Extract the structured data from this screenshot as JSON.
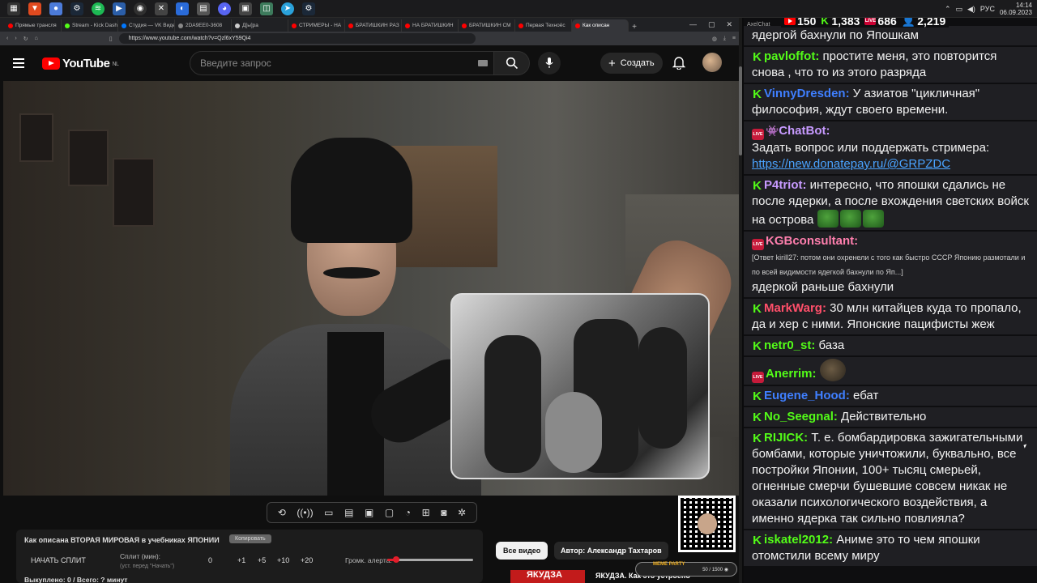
{
  "taskbar": {
    "icons": [
      "menu-icon",
      "browser-icon",
      "chrome-icon",
      "steam-icon",
      "spotify-icon",
      "media-icon",
      "obs-icon",
      "game-icon",
      "app-icon",
      "app-icon",
      "discord-icon",
      "app-icon",
      "telegram-icon",
      "app-icon",
      "steam-icon"
    ],
    "lang": "РУС",
    "time": "14:14",
    "date": "06.09.2023"
  },
  "browser": {
    "tabs": [
      {
        "label": "Прямые трансля",
        "color": "#ff0000"
      },
      {
        "label": "Stream - Kick Dash",
        "color": "#53fc18"
      },
      {
        "label": "Студия — VK Видео",
        "color": "#0077ff"
      },
      {
        "label": "2DA9EE0-3608",
        "color": "#888888"
      },
      {
        "label": "Д[ы]ра",
        "color": "#cccccc"
      },
      {
        "label": "СТРИМЕРЫ - НА",
        "color": "#ff0000"
      },
      {
        "label": "БРАТИШКИН РАЗ",
        "color": "#ff0000"
      },
      {
        "label": "НА БРАТИШКИН",
        "color": "#ff0000"
      },
      {
        "label": "БРАТИШКИН СМ",
        "color": "#ff0000"
      },
      {
        "label": "Первая Техноёс",
        "color": "#ff0000"
      },
      {
        "label": "Как описан",
        "color": "#ff0000"
      }
    ],
    "url": "https://www.youtube.com/watch?v=Qzl6xY59Qi4"
  },
  "youtube": {
    "logo": "YouTube",
    "region": "NL",
    "search_placeholder": "Введите запрос",
    "create_label": "Создать"
  },
  "video_controls": [
    "repeat-icon",
    "broadcast-icon",
    "cast-icon",
    "clapper-icon",
    "picture-icon",
    "window-icon",
    "speed-icon",
    "add-video-icon",
    "camera-icon",
    "settings-icon"
  ],
  "split_panel": {
    "title": "Как описана ВТОРАЯ МИРОВАЯ в учебниках ЯПОНИИ",
    "copy": "Копировать",
    "start": "НАЧАТЬ СПЛИТ",
    "split_min": "Сплит (мин):",
    "split_hint": "(уст. перед \"Начать\")",
    "value": "0",
    "increments": [
      "+1",
      "+5",
      "+10",
      "+20"
    ],
    "alert_label": "Громк. алерта:",
    "alert_volume": 0.1,
    "bought": "Выкуплено: 0 / Всего: ? минут"
  },
  "chips": {
    "all": "Все видео",
    "author": "Автор: Александр Тахтаров"
  },
  "reco": {
    "thumb_text": "ЯКУДЗА",
    "title": "ЯКУДЗА. Как это устроено"
  },
  "meme": {
    "tag": "MEME PARTY",
    "counter": "50 / 1500 ◉"
  },
  "chat": {
    "app": "AxelChat",
    "stats": {
      "youtube": "150",
      "kick": "1,383",
      "vk": "686",
      "viewers": "2,219"
    },
    "messages": [
      {
        "platform": "none",
        "nick": "",
        "color": "#ffffff",
        "text": "ядергой бахнули по Япошкам"
      },
      {
        "platform": "kick",
        "nick": "pavloffot:",
        "color": "#53fc18",
        "text": "простите меня, это повторится снова , что то из этого разряда"
      },
      {
        "platform": "kick",
        "nick": "VinnyDresden:",
        "color": "#3f7fff",
        "text": "У азиатов \"цикличная\" философия, ждут своего времени."
      },
      {
        "platform": "live",
        "nick": "ChatBot:",
        "color": "#c79aff",
        "text": "Задать вопрос или поддержать стримера:",
        "link": "https://new.donatepay.ru/@GRPZDC"
      },
      {
        "platform": "kick",
        "nick": "P4triot:",
        "color": "#c79aff",
        "text": "интересно, что япошки сдались не после ядерки, а после вхождения светских войск на острова",
        "emotes": 3
      },
      {
        "platform": "live",
        "nick": "KGBconsultant:",
        "color": "#ff7fae",
        "quote": "[Ответ kirill27: потом они охренели с того как быстро СССР Японию размотали и по всей видимости ядегкой бахнули по Яп...]",
        "text": "ядеркой раньше бахнули"
      },
      {
        "platform": "kick",
        "nick": "MarkWarg:",
        "color": "#ff4f6a",
        "text": "30 млн китайцев куда то пропало, да и хер с ними. Японские пацифисты жеж"
      },
      {
        "platform": "kick",
        "nick": "netr0_st:",
        "color": "#53fc18",
        "text": "база"
      },
      {
        "platform": "live",
        "nick": "Anerrim:",
        "color": "#53fc18",
        "text": "",
        "sticker": true
      },
      {
        "platform": "kick",
        "nick": "Eugene_Hood:",
        "color": "#3f7fff",
        "text": "ебат"
      },
      {
        "platform": "kick",
        "nick": "No_Seegnal:",
        "color": "#53fc18",
        "text": "Действительно"
      },
      {
        "platform": "kick",
        "nick": "RIJICK:",
        "color": "#53fc18",
        "text": "Т. е. бомбардировка зажигательными бомбами, которые уничтожили, буквально, все постройки Японии, 100+ тысяц смерьей, огненные смерчи бушевшие совсем никак не оказали психологического воздействия, а именно ядерка так сильно повлияла?"
      },
      {
        "platform": "kick",
        "nick": "iskatel2012:",
        "color": "#53fc18",
        "text": "Аниме это то чем япошки отомстили всему миру"
      }
    ]
  }
}
